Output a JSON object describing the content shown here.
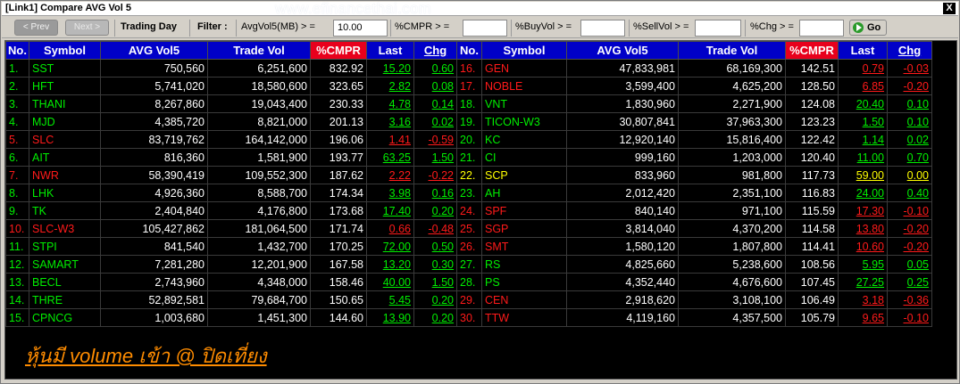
{
  "window": {
    "title": "[Link1] Compare AVG Vol 5",
    "watermark": "www.efinancethai.com",
    "close_glyph": "X"
  },
  "toolbar": {
    "prev_label": "< Prev",
    "next_label": "Next >",
    "trading_day_label": "Trading Day",
    "filter_label": "Filter :",
    "avgvol_label": "AvgVol5(MB) > =",
    "avgvol_value": "10.00",
    "cmpr_label": "%CMPR > =",
    "cmpr_value": "",
    "buyvol_label": "%BuyVol > =",
    "buyvol_value": "",
    "sellvol_label": "%SellVol > =",
    "sellvol_value": "",
    "chg_label": "%Chg > =",
    "chg_value": "",
    "go_label": "Go",
    "go_icon": "go-arrow-icon"
  },
  "colors": {
    "up": "#00ee00",
    "down": "#ff1a1a",
    "unchanged": "#ffff00",
    "header_bg": "#0000c8",
    "cmpr_header_bg": "#e8001c"
  },
  "columns": [
    "No.",
    "Symbol",
    "AVG Vol5",
    "Trade Vol",
    "%CMPR",
    "Last",
    "Chg"
  ],
  "left_rows": [
    {
      "no": "1.",
      "symbol": "SST",
      "avg": "750,560",
      "trade": "6,251,600",
      "cmpr": "832.92",
      "last": "15.20",
      "chg": "0.60",
      "dir": "up"
    },
    {
      "no": "2.",
      "symbol": "HFT",
      "avg": "5,741,020",
      "trade": "18,580,600",
      "cmpr": "323.65",
      "last": "2.82",
      "chg": "0.08",
      "dir": "up"
    },
    {
      "no": "3.",
      "symbol": "THANI",
      "avg": "8,267,860",
      "trade": "19,043,400",
      "cmpr": "230.33",
      "last": "4.78",
      "chg": "0.14",
      "dir": "up"
    },
    {
      "no": "4.",
      "symbol": "MJD",
      "avg": "4,385,720",
      "trade": "8,821,000",
      "cmpr": "201.13",
      "last": "3.16",
      "chg": "0.02",
      "dir": "up"
    },
    {
      "no": "5.",
      "symbol": "SLC",
      "avg": "83,719,762",
      "trade": "164,142,000",
      "cmpr": "196.06",
      "last": "1.41",
      "chg": "-0.59",
      "dir": "down"
    },
    {
      "no": "6.",
      "symbol": "AIT",
      "avg": "816,360",
      "trade": "1,581,900",
      "cmpr": "193.77",
      "last": "63.25",
      "chg": "1.50",
      "dir": "up"
    },
    {
      "no": "7.",
      "symbol": "NWR",
      "avg": "58,390,419",
      "trade": "109,552,300",
      "cmpr": "187.62",
      "last": "2.22",
      "chg": "-0.22",
      "dir": "down"
    },
    {
      "no": "8.",
      "symbol": "LHK",
      "avg": "4,926,360",
      "trade": "8,588,700",
      "cmpr": "174.34",
      "last": "3.98",
      "chg": "0.16",
      "dir": "up"
    },
    {
      "no": "9.",
      "symbol": "TK",
      "avg": "2,404,840",
      "trade": "4,176,800",
      "cmpr": "173.68",
      "last": "17.40",
      "chg": "0.20",
      "dir": "up"
    },
    {
      "no": "10.",
      "symbol": "SLC-W3",
      "avg": "105,427,862",
      "trade": "181,064,500",
      "cmpr": "171.74",
      "last": "0.66",
      "chg": "-0.48",
      "dir": "down"
    },
    {
      "no": "11.",
      "symbol": "STPI",
      "avg": "841,540",
      "trade": "1,432,700",
      "cmpr": "170.25",
      "last": "72.00",
      "chg": "0.50",
      "dir": "up"
    },
    {
      "no": "12.",
      "symbol": "SAMART",
      "avg": "7,281,280",
      "trade": "12,201,900",
      "cmpr": "167.58",
      "last": "13.20",
      "chg": "0.30",
      "dir": "up"
    },
    {
      "no": "13.",
      "symbol": "BECL",
      "avg": "2,743,960",
      "trade": "4,348,000",
      "cmpr": "158.46",
      "last": "40.00",
      "chg": "1.50",
      "dir": "up"
    },
    {
      "no": "14.",
      "symbol": "THRE",
      "avg": "52,892,581",
      "trade": "79,684,700",
      "cmpr": "150.65",
      "last": "5.45",
      "chg": "0.20",
      "dir": "up"
    },
    {
      "no": "15.",
      "symbol": "CPNCG",
      "avg": "1,003,680",
      "trade": "1,451,300",
      "cmpr": "144.60",
      "last": "13.90",
      "chg": "0.20",
      "dir": "up"
    }
  ],
  "right_rows": [
    {
      "no": "16.",
      "symbol": "GEN",
      "avg": "47,833,981",
      "trade": "68,169,300",
      "cmpr": "142.51",
      "last": "0.79",
      "chg": "-0.03",
      "dir": "down"
    },
    {
      "no": "17.",
      "symbol": "NOBLE",
      "avg": "3,599,400",
      "trade": "4,625,200",
      "cmpr": "128.50",
      "last": "6.85",
      "chg": "-0.20",
      "dir": "down"
    },
    {
      "no": "18.",
      "symbol": "VNT",
      "avg": "1,830,960",
      "trade": "2,271,900",
      "cmpr": "124.08",
      "last": "20.40",
      "chg": "0.10",
      "dir": "up"
    },
    {
      "no": "19.",
      "symbol": "TICON-W3",
      "avg": "30,807,841",
      "trade": "37,963,300",
      "cmpr": "123.23",
      "last": "1.50",
      "chg": "0.10",
      "dir": "up"
    },
    {
      "no": "20.",
      "symbol": "KC",
      "avg": "12,920,140",
      "trade": "15,816,400",
      "cmpr": "122.42",
      "last": "1.14",
      "chg": "0.02",
      "dir": "up"
    },
    {
      "no": "21.",
      "symbol": "CI",
      "avg": "999,160",
      "trade": "1,203,000",
      "cmpr": "120.40",
      "last": "11.00",
      "chg": "0.70",
      "dir": "up"
    },
    {
      "no": "22.",
      "symbol": "SCP",
      "avg": "833,960",
      "trade": "981,800",
      "cmpr": "117.73",
      "last": "59.00",
      "chg": "0.00",
      "dir": "unchanged"
    },
    {
      "no": "23.",
      "symbol": "AH",
      "avg": "2,012,420",
      "trade": "2,351,100",
      "cmpr": "116.83",
      "last": "24.00",
      "chg": "0.40",
      "dir": "up"
    },
    {
      "no": "24.",
      "symbol": "SPF",
      "avg": "840,140",
      "trade": "971,100",
      "cmpr": "115.59",
      "last": "17.30",
      "chg": "-0.10",
      "dir": "down"
    },
    {
      "no": "25.",
      "symbol": "SGP",
      "avg": "3,814,040",
      "trade": "4,370,200",
      "cmpr": "114.58",
      "last": "13.80",
      "chg": "-0.20",
      "dir": "down"
    },
    {
      "no": "26.",
      "symbol": "SMT",
      "avg": "1,580,120",
      "trade": "1,807,800",
      "cmpr": "114.41",
      "last": "10.60",
      "chg": "-0.20",
      "dir": "down"
    },
    {
      "no": "27.",
      "symbol": "RS",
      "avg": "4,825,660",
      "trade": "5,238,600",
      "cmpr": "108.56",
      "last": "5.95",
      "chg": "0.05",
      "dir": "up"
    },
    {
      "no": "28.",
      "symbol": "PS",
      "avg": "4,352,440",
      "trade": "4,676,600",
      "cmpr": "107.45",
      "last": "27.25",
      "chg": "0.25",
      "dir": "up"
    },
    {
      "no": "29.",
      "symbol": "CEN",
      "avg": "2,918,620",
      "trade": "3,108,100",
      "cmpr": "106.49",
      "last": "3.18",
      "chg": "-0.36",
      "dir": "down"
    },
    {
      "no": "30.",
      "symbol": "TTW",
      "avg": "4,119,160",
      "trade": "4,357,500",
      "cmpr": "105.79",
      "last": "9.65",
      "chg": "-0.10",
      "dir": "down"
    }
  ],
  "caption": "หุ้นมี volume เข้า @ ปิดเที่ยง"
}
